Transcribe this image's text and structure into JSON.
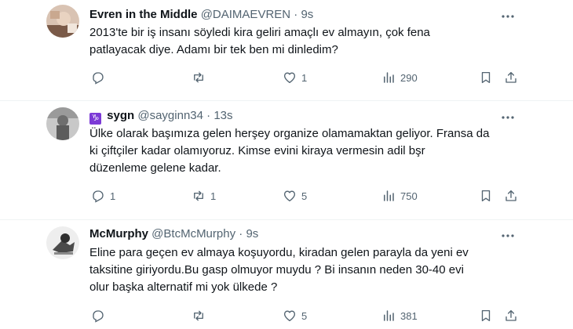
{
  "tweets": [
    {
      "name": "Evren in the Middle",
      "handle": "@DAIMAEVREN",
      "dot": "·",
      "time": "9s",
      "text_lines": [
        "2013'te bir iş insanı söyledi kira geliri amaçlı ev almayın, çok fena",
        "patlayacak diye. Adamı bir tek ben mi dinledim?"
      ],
      "replies": "",
      "reposts": "",
      "likes": "1",
      "views": "290"
    },
    {
      "badge": "♑",
      "name": "sygn",
      "handle": "@sayginn34",
      "dot": "·",
      "time": "13s",
      "text_lines": [
        "Ülke olarak başımıza gelen herşey organize olamamaktan geliyor. Fransa da",
        "ki çiftçiler kadar olamıyoruz. Kimse evini kiraya vermesin adil bşr",
        "düzenleme gelene kadar."
      ],
      "replies": "1",
      "reposts": "1",
      "likes": "5",
      "views": "750"
    },
    {
      "name": "McMurphy",
      "handle": "@BtcMcMurphy",
      "dot": "·",
      "time": "9s",
      "text_lines": [
        "Eline para geçen ev almaya koşuyordu, kiradan gelen parayla da yeni ev",
        "taksitine giriyordu.Bu gasp olmuyor muydu ? Bi insanın neden 30-40 evi",
        "olur başka alternatif mi yok ülkede ?"
      ],
      "replies": "",
      "reposts": "",
      "likes": "5",
      "views": "381"
    }
  ],
  "icons": {
    "reply": "reply-icon",
    "repost": "repost-icon",
    "like": "heart-icon",
    "views": "views-icon",
    "bookmark": "bookmark-icon",
    "share": "share-icon",
    "more": "more-icon"
  },
  "colors": {
    "text": "#0f1419",
    "secondary": "#536471",
    "divider": "#eff3f4",
    "badge": "#7c3ad6"
  }
}
